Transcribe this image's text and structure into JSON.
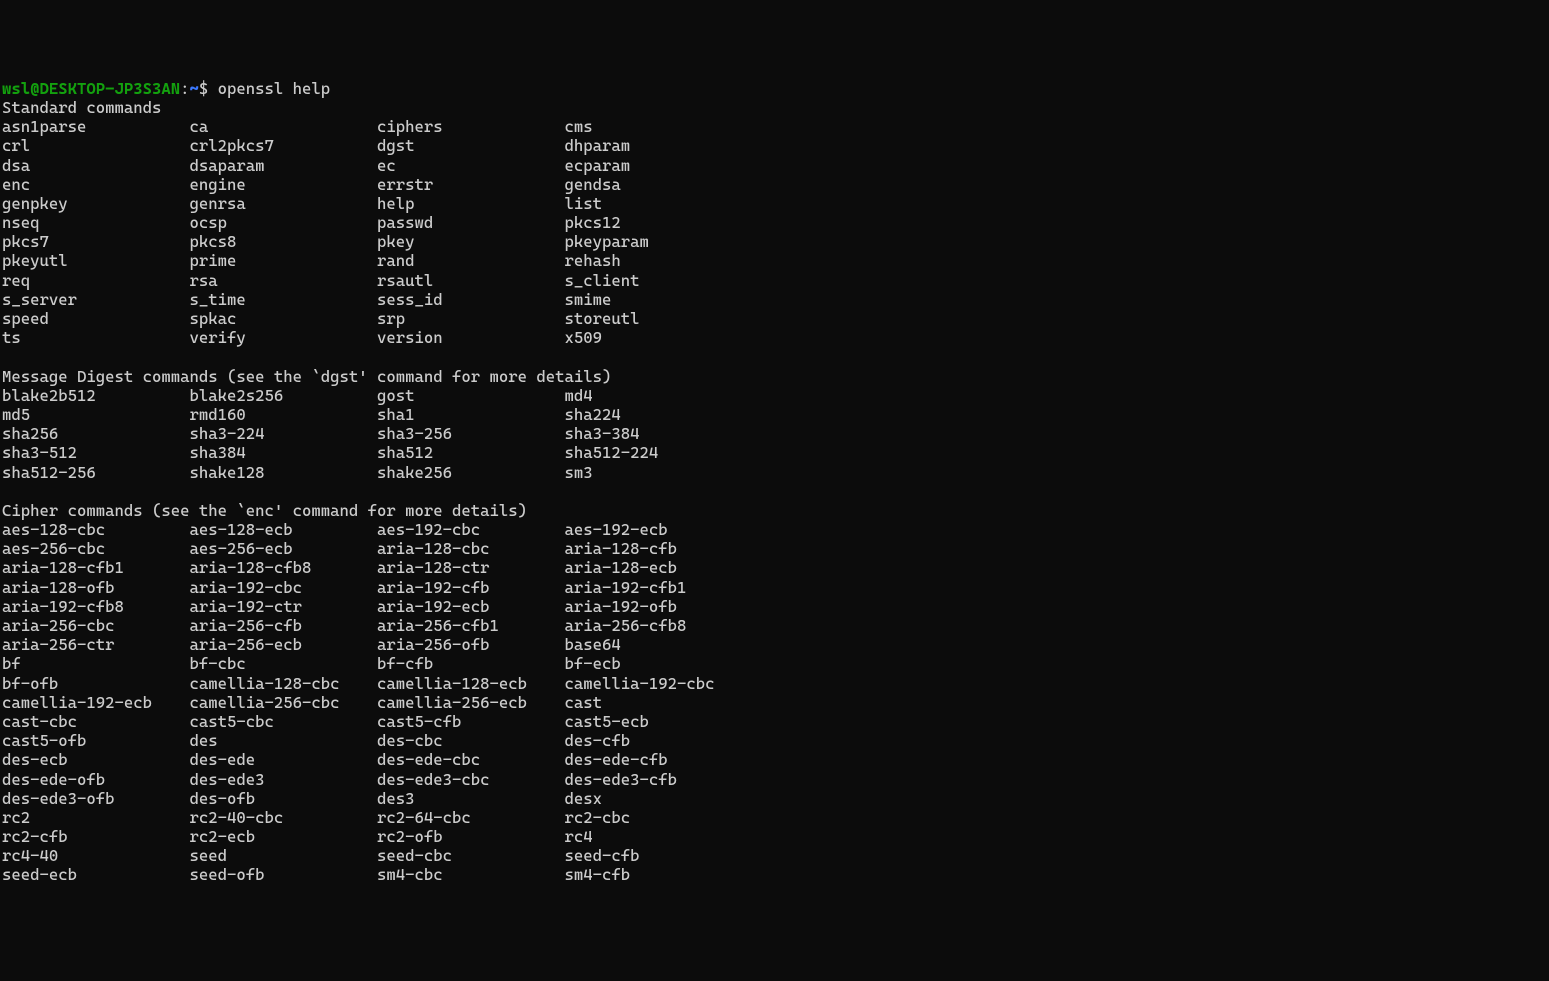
{
  "prompt": {
    "user_host": "wsl@DESKTOP-JP3S3AN",
    "colon": ":",
    "path": "~",
    "dollar": "$",
    "command": "openssl help"
  },
  "sections": [
    {
      "title": "Standard commands",
      "rows": [
        [
          "asn1parse",
          "ca",
          "ciphers",
          "cms"
        ],
        [
          "crl",
          "crl2pkcs7",
          "dgst",
          "dhparam"
        ],
        [
          "dsa",
          "dsaparam",
          "ec",
          "ecparam"
        ],
        [
          "enc",
          "engine",
          "errstr",
          "gendsa"
        ],
        [
          "genpkey",
          "genrsa",
          "help",
          "list"
        ],
        [
          "nseq",
          "ocsp",
          "passwd",
          "pkcs12"
        ],
        [
          "pkcs7",
          "pkcs8",
          "pkey",
          "pkeyparam"
        ],
        [
          "pkeyutl",
          "prime",
          "rand",
          "rehash"
        ],
        [
          "req",
          "rsa",
          "rsautl",
          "s_client"
        ],
        [
          "s_server",
          "s_time",
          "sess_id",
          "smime"
        ],
        [
          "speed",
          "spkac",
          "srp",
          "storeutl"
        ],
        [
          "ts",
          "verify",
          "version",
          "x509"
        ]
      ]
    },
    {
      "title": "Message Digest commands (see the `dgst' command for more details)",
      "rows": [
        [
          "blake2b512",
          "blake2s256",
          "gost",
          "md4"
        ],
        [
          "md5",
          "rmd160",
          "sha1",
          "sha224"
        ],
        [
          "sha256",
          "sha3-224",
          "sha3-256",
          "sha3-384"
        ],
        [
          "sha3-512",
          "sha384",
          "sha512",
          "sha512-224"
        ],
        [
          "sha512-256",
          "shake128",
          "shake256",
          "sm3"
        ]
      ]
    },
    {
      "title": "Cipher commands (see the `enc' command for more details)",
      "rows": [
        [
          "aes-128-cbc",
          "aes-128-ecb",
          "aes-192-cbc",
          "aes-192-ecb"
        ],
        [
          "aes-256-cbc",
          "aes-256-ecb",
          "aria-128-cbc",
          "aria-128-cfb"
        ],
        [
          "aria-128-cfb1",
          "aria-128-cfb8",
          "aria-128-ctr",
          "aria-128-ecb"
        ],
        [
          "aria-128-ofb",
          "aria-192-cbc",
          "aria-192-cfb",
          "aria-192-cfb1"
        ],
        [
          "aria-192-cfb8",
          "aria-192-ctr",
          "aria-192-ecb",
          "aria-192-ofb"
        ],
        [
          "aria-256-cbc",
          "aria-256-cfb",
          "aria-256-cfb1",
          "aria-256-cfb8"
        ],
        [
          "aria-256-ctr",
          "aria-256-ecb",
          "aria-256-ofb",
          "base64"
        ],
        [
          "bf",
          "bf-cbc",
          "bf-cfb",
          "bf-ecb"
        ],
        [
          "bf-ofb",
          "camellia-128-cbc",
          "camellia-128-ecb",
          "camellia-192-cbc"
        ],
        [
          "camellia-192-ecb",
          "camellia-256-cbc",
          "camellia-256-ecb",
          "cast"
        ],
        [
          "cast-cbc",
          "cast5-cbc",
          "cast5-cfb",
          "cast5-ecb"
        ],
        [
          "cast5-ofb",
          "des",
          "des-cbc",
          "des-cfb"
        ],
        [
          "des-ecb",
          "des-ede",
          "des-ede-cbc",
          "des-ede-cfb"
        ],
        [
          "des-ede-ofb",
          "des-ede3",
          "des-ede3-cbc",
          "des-ede3-cfb"
        ],
        [
          "des-ede3-ofb",
          "des-ofb",
          "des3",
          "desx"
        ],
        [
          "rc2",
          "rc2-40-cbc",
          "rc2-64-cbc",
          "rc2-cbc"
        ],
        [
          "rc2-cfb",
          "rc2-ecb",
          "rc2-ofb",
          "rc4"
        ],
        [
          "rc4-40",
          "seed",
          "seed-cbc",
          "seed-cfb"
        ],
        [
          "seed-ecb",
          "seed-ofb",
          "sm4-cbc",
          "sm4-cfb"
        ]
      ]
    }
  ]
}
